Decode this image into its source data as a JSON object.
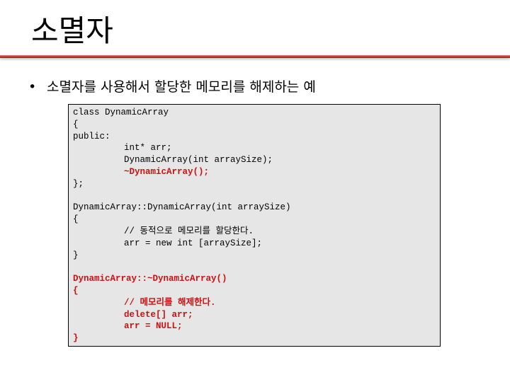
{
  "title": "소멸자",
  "bullet": "소멸자를 사용해서 할당한 메모리를 해제하는 예",
  "colors": {
    "accent_rule": "#c0392b",
    "highlight_code": "#cc1111",
    "code_bg": "#e6e6e6"
  },
  "code_lines": [
    {
      "text": "class DynamicArray",
      "indent": false,
      "highlight": false
    },
    {
      "text": "{",
      "indent": false,
      "highlight": false
    },
    {
      "text": "public:",
      "indent": false,
      "highlight": false
    },
    {
      "text": "int* arr;",
      "indent": true,
      "highlight": false
    },
    {
      "text": "DynamicArray(int arraySize);",
      "indent": true,
      "highlight": false
    },
    {
      "text": "~DynamicArray();",
      "indent": true,
      "highlight": true
    },
    {
      "text": "};",
      "indent": false,
      "highlight": false
    },
    {
      "text": "",
      "indent": false,
      "highlight": false
    },
    {
      "text": "DynamicArray::DynamicArray(int arraySize)",
      "indent": false,
      "highlight": false
    },
    {
      "text": "{",
      "indent": false,
      "highlight": false
    },
    {
      "text": "// 동적으로 메모리를 할당한다.",
      "indent": true,
      "highlight": false
    },
    {
      "text": "arr = new int [arraySize];",
      "indent": true,
      "highlight": false
    },
    {
      "text": "}",
      "indent": false,
      "highlight": false
    },
    {
      "text": "",
      "indent": false,
      "highlight": false
    },
    {
      "text": "DynamicArray::~DynamicArray()",
      "indent": false,
      "highlight": true
    },
    {
      "text": "{",
      "indent": false,
      "highlight": true
    },
    {
      "text": "// 메모리를 해제한다.",
      "indent": true,
      "highlight": true
    },
    {
      "text": "delete[] arr;",
      "indent": true,
      "highlight": true
    },
    {
      "text": "arr = NULL;",
      "indent": true,
      "highlight": true
    },
    {
      "text": "}",
      "indent": false,
      "highlight": true
    }
  ]
}
